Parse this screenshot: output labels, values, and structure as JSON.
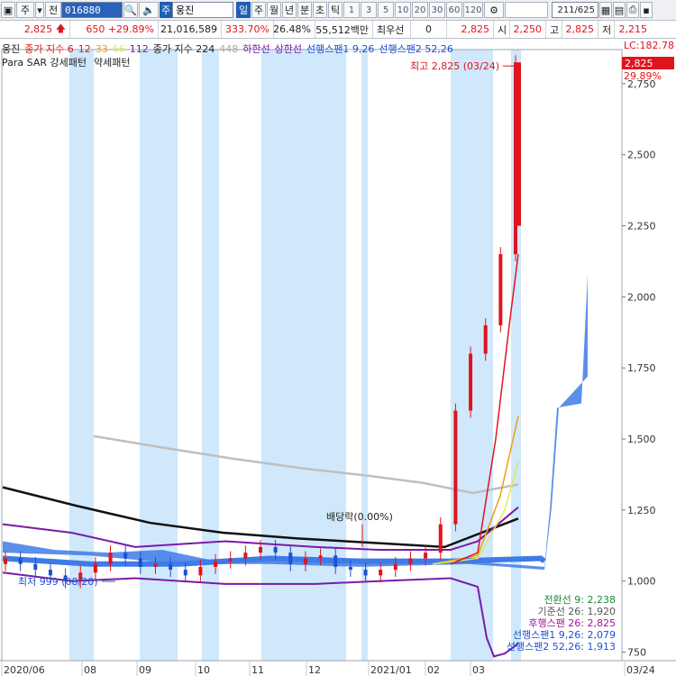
{
  "toolbar": {
    "stock_code": "016880",
    "stock_name": "웅진",
    "prefix_label": "주",
    "prev_label": "전",
    "name_prefix": "주",
    "periods": [
      "일",
      "주",
      "월",
      "년",
      "분",
      "초",
      "틱"
    ],
    "minutes": [
      "1",
      "3",
      "5",
      "10",
      "20",
      "30",
      "60",
      "120"
    ],
    "counter": "211/625"
  },
  "quote": {
    "price": "2,825",
    "change": "650",
    "change_rate": "+29.89%",
    "volume": "21,016,589",
    "volume_ratio": "333.70%",
    "turnover": "26.48%",
    "amount": "55,512백만",
    "priority_label": "최우선",
    "priority_value": "0",
    "price2": "2,825",
    "open_label": "시",
    "open": "2,250",
    "high_label": "고",
    "high": "2,825",
    "low_label": "저",
    "low": "2,215"
  },
  "legend": {
    "items": [
      {
        "text": "웅진",
        "color": "#222222"
      },
      {
        "text": "종가 지수 6",
        "color": "#e0141e"
      },
      {
        "text": "12",
        "color": "#e0141e"
      },
      {
        "text": "33",
        "color": "#f39c12"
      },
      {
        "text": "66",
        "color": "#e6e65a"
      },
      {
        "text": "112",
        "color": "#7a1aa8"
      },
      {
        "text": "종가 지수 224",
        "color": "#222222"
      },
      {
        "text": "448",
        "color": "#aaaaaa"
      },
      {
        "text": "하한선",
        "color": "#7a1aa8"
      },
      {
        "text": "상한선",
        "color": "#7a1aa8"
      },
      {
        "text": "선행스팬1 9,26",
        "color": "#1e50d2"
      },
      {
        "text": "선행스팬2 52,26",
        "color": "#1e50d2"
      }
    ],
    "line2": [
      {
        "text": "Para SAR 강세패턴",
        "color": "#222222"
      },
      {
        "text": "약세패턴",
        "color": "#222222"
      }
    ]
  },
  "chart_data": {
    "type": "candlestick",
    "title": "",
    "x_tick_labels": [
      "2020/06",
      "08",
      "09",
      "10",
      "11",
      "12",
      "2021/01",
      "02",
      "03",
      "03/24"
    ],
    "y_ticks": [
      750,
      1000,
      1250,
      1500,
      1750,
      2000,
      2250,
      2500,
      2750
    ],
    "ylim": [
      720,
      2870
    ],
    "price_axis_labels": {
      "lc": "LC:182.78",
      "current": "2,825",
      "current_rate": "29.89%"
    },
    "annotations": {
      "high": "최고 2,825 (03/24)",
      "low": "최저 999 (08/20)",
      "dividend": "배당락(0.00%)"
    },
    "indicator_panel": [
      {
        "text": "전환선 9: 2,238",
        "color": "#1a8a3a"
      },
      {
        "text": "기준선 26: 1,920",
        "color": "#555555"
      },
      {
        "text": "후행스팬 26: 2,825",
        "color": "#a0149c"
      },
      {
        "text": "선행스팬1 9,26: 2,079",
        "color": "#1e50d2"
      },
      {
        "text": "선행스팬2 52,26: 1,913",
        "color": "#1e50d2"
      }
    ],
    "series": [
      {
        "name": "종가 지수 224",
        "values": [
          1330,
          1265,
          1205,
          1170,
          1150,
          1135,
          1120,
          1220
        ]
      },
      {
        "name": "448",
        "values": [
          1510,
          1470,
          1430,
          1395,
          1370,
          1345,
          1310,
          1340
        ]
      },
      {
        "name": "선행스팬1 9,26",
        "values": [
          1080,
          1060,
          1060,
          1080,
          1070,
          1070,
          1080,
          2079
        ]
      },
      {
        "name": "선행스팬2 52,26",
        "values": [
          1130,
          1090,
          1060,
          1060,
          1065,
          1070,
          1070,
          1913
        ]
      }
    ],
    "candles_close": [
      1080,
      1060,
      1040,
      1020,
      1000,
      1030,
      1060,
      1100,
      1080,
      1050,
      1060,
      1040,
      1020,
      1050,
      1070,
      1080,
      1100,
      1120,
      1100,
      1060,
      1080,
      1090,
      1050,
      1040,
      1020,
      1040,
      1060,
      1080,
      1100,
      1200,
      1600,
      1800,
      1900,
      2150,
      2825
    ]
  }
}
